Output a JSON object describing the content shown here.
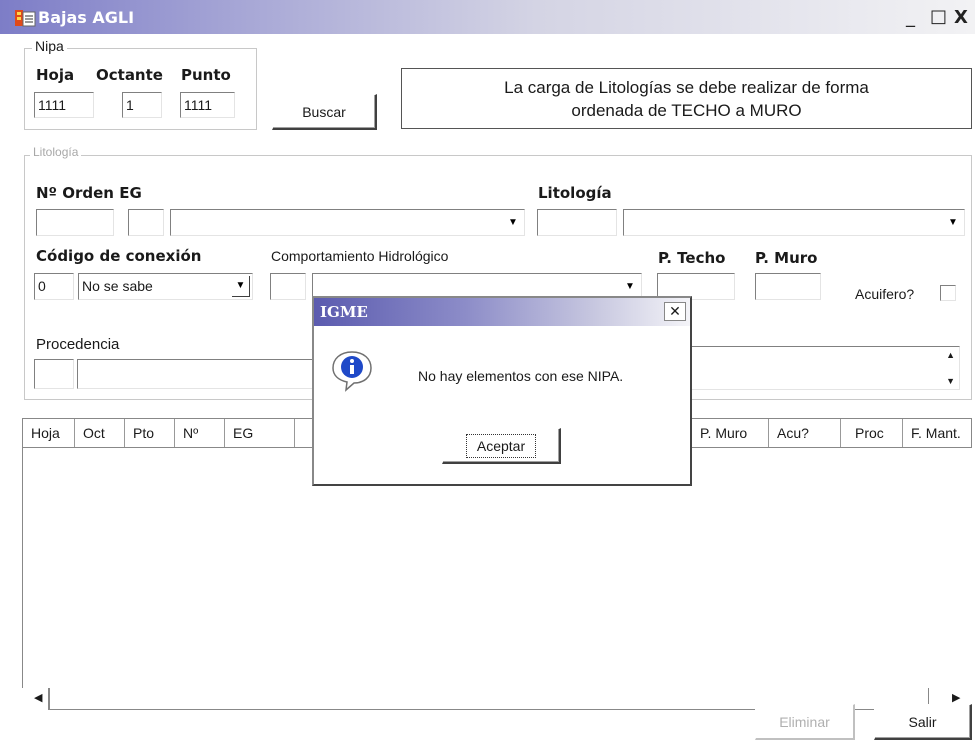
{
  "window": {
    "title": "Bajas AGLI",
    "minimize": "_",
    "maximize": "□",
    "close": "X"
  },
  "nipa": {
    "legend": "Nipa",
    "hoja_label": "Hoja",
    "octante_label": "Octante",
    "punto_label": "Punto",
    "hoja_value": "1111",
    "octante_value": "1",
    "punto_value": "1111",
    "buscar": "Buscar"
  },
  "notice": {
    "line1": "La carga de Litologías se debe realizar de forma",
    "line2": "ordenada de TECHO a MURO"
  },
  "litologia": {
    "legend": "Litología",
    "orden_label": "Nº Orden EG",
    "litologia_label": "Litología",
    "codigo_label": "Código de conexión",
    "codigo_value": "0",
    "codigo_select": "No se sabe",
    "comportamiento_label": "Comportamiento Hidrológico",
    "ptecho_label": "P. Techo",
    "pmuro_label": "P. Muro",
    "acuifero_label": "Acuifero?",
    "procedencia_label": "Procedencia"
  },
  "table": {
    "columns_left": [
      "Hoja",
      "Oct",
      "Pto",
      "Nº",
      "EG"
    ],
    "columns_right": [
      "P. Muro",
      "Acu?",
      "Proc",
      "F. Mant."
    ]
  },
  "dialog": {
    "title": "IGME",
    "close": "✕",
    "message": "No hay elementos con ese NIPA.",
    "ok": "Aceptar"
  },
  "footer": {
    "eliminar": "Eliminar",
    "salir": "Salir"
  },
  "icons": {
    "app": "app-icon",
    "info": "info-icon"
  },
  "colors": {
    "title_start": "#7d7dc7",
    "dialog_title": "#5b5baf",
    "info_blue": "#1f49c8"
  }
}
